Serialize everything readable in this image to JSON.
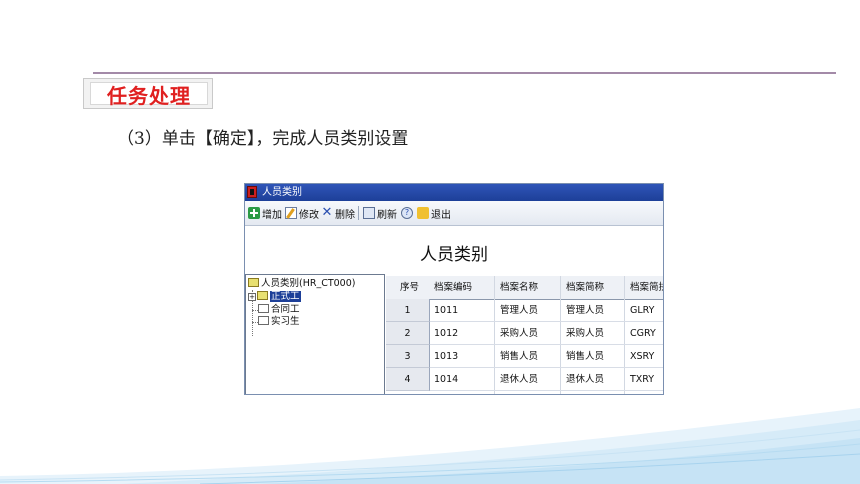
{
  "slide": {
    "section_title": "任务处理",
    "step_text": "（3）单击【确定】，完成人员类别设置"
  },
  "window": {
    "title": "人员类别",
    "toolbar": {
      "add": "增加",
      "edit": "修改",
      "delete": "删除",
      "refresh": "刷新",
      "exit": "退出"
    },
    "heading": "人员类别",
    "tree": {
      "root": "人员类别(HR_CT000)",
      "items": [
        "正式工",
        "合同工",
        "实习生"
      ],
      "selected": "正式工"
    },
    "grid": {
      "columns": [
        "序号",
        "档案编码",
        "档案名称",
        "档案简称",
        "档案简拼"
      ],
      "rows": [
        {
          "no": "1",
          "code": "1011",
          "name": "管理人员",
          "short": "管理人员",
          "pinyin": "GLRY"
        },
        {
          "no": "2",
          "code": "1012",
          "name": "采购人员",
          "short": "采购人员",
          "pinyin": "CGRY"
        },
        {
          "no": "3",
          "code": "1013",
          "name": "销售人员",
          "short": "销售人员",
          "pinyin": "XSRY"
        },
        {
          "no": "4",
          "code": "1014",
          "name": "退休人员",
          "short": "退休人员",
          "pinyin": "TXRY"
        }
      ]
    }
  }
}
